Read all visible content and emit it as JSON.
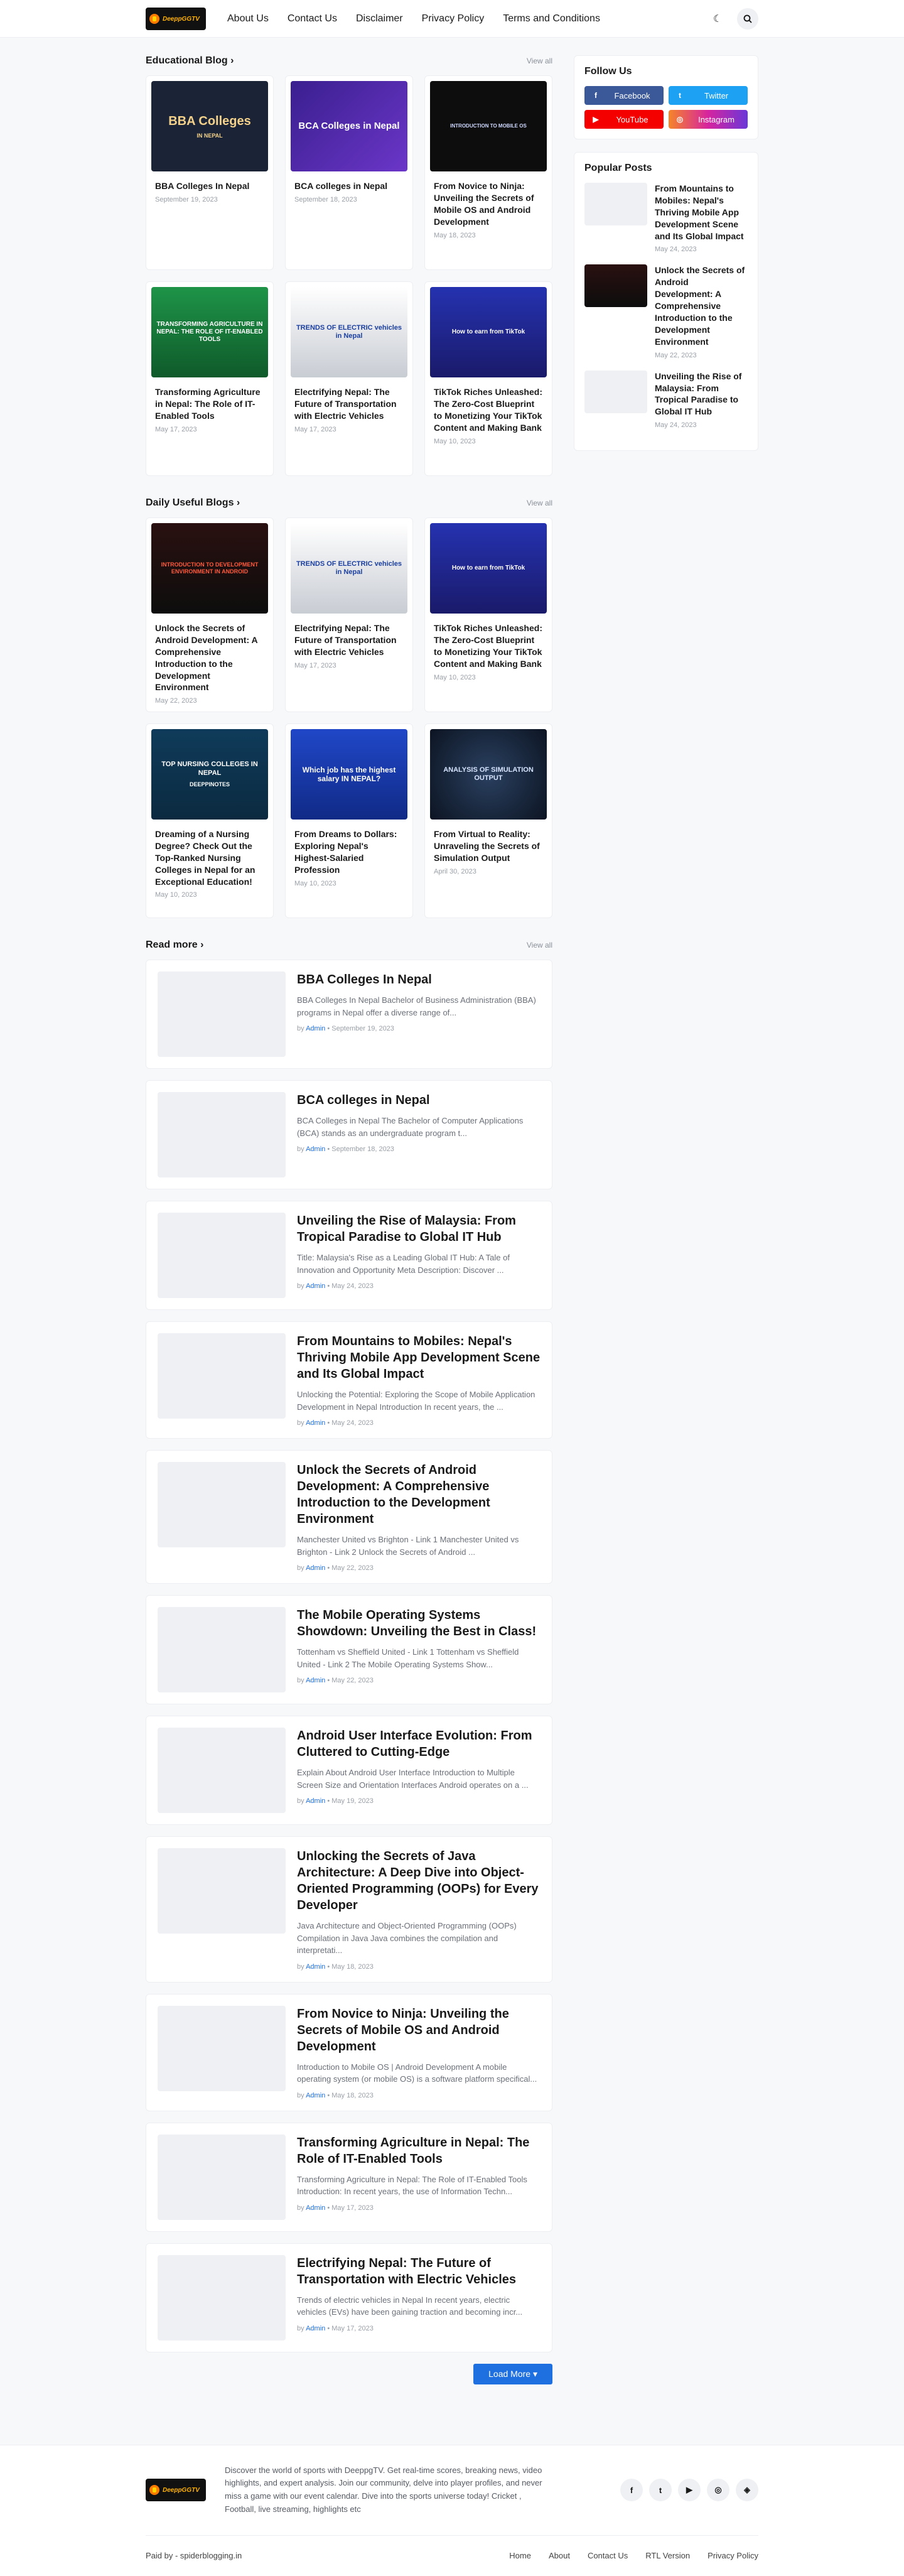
{
  "header": {
    "logo_text": "DeeppGGTV",
    "nav": [
      "About Us",
      "Contact Us",
      "Disclaimer",
      "Privacy Policy",
      "Terms and Conditions"
    ],
    "icons": {
      "theme": "moon-icon",
      "search": "search-icon"
    }
  },
  "sections": {
    "educational": {
      "title": "Educational Blog ›",
      "view_all": "View all",
      "cards": [
        {
          "title": "BBA Colleges In Nepal",
          "date": "September 19, 2023",
          "img_text": "BBA Colleges",
          "img_sub": "IN NEPAL"
        },
        {
          "title": "BCA colleges in Nepal",
          "date": "September 18, 2023",
          "img_text": "BCA Colleges in Nepal",
          "img_sub": ""
        },
        {
          "title": "From Novice to Ninja: Unveiling the Secrets of Mobile OS and Android Development",
          "date": "May 18, 2023",
          "img_text": "INTRODUCTION TO MOBILE OS",
          "img_sub": ""
        },
        {
          "title": "Transforming Agriculture in Nepal: The Role of IT-Enabled Tools",
          "date": "May 17, 2023",
          "img_text": "TRANSFORMING AGRICULTURE IN NEPAL: THE ROLE OF IT-ENABLED TOOLS",
          "img_sub": ""
        },
        {
          "title": "Electrifying Nepal: The Future of Transportation with Electric Vehicles",
          "date": "May 17, 2023",
          "img_text": "TRENDS OF ELECTRIC vehicles in Nepal",
          "img_sub": ""
        },
        {
          "title": "TikTok Riches Unleashed: The Zero-Cost Blueprint to Monetizing Your TikTok Content and Making Bank",
          "date": "May 10, 2023",
          "img_text": "How to earn from TikTok",
          "img_sub": ""
        }
      ]
    },
    "daily": {
      "title": "Daily Useful Blogs ›",
      "view_all": "View all",
      "cards": [
        {
          "title": "Unlock the Secrets of Android Development: A Comprehensive Introduction to the Development Environment",
          "date": "May 22, 2023",
          "img_text": "INTRODUCTION TO DEVELOPMENT ENVIRONMENT IN ANDROID",
          "img_sub": ""
        },
        {
          "title": "Electrifying Nepal: The Future of Transportation with Electric Vehicles",
          "date": "May 17, 2023",
          "img_text": "TRENDS OF ELECTRIC vehicles in Nepal",
          "img_sub": ""
        },
        {
          "title": "TikTok Riches Unleashed: The Zero-Cost Blueprint to Monetizing Your TikTok Content and Making Bank",
          "date": "May 10, 2023",
          "img_text": "How to earn from TikTok",
          "img_sub": ""
        },
        {
          "title": "Dreaming of a Nursing Degree? Check Out the Top-Ranked Nursing Colleges in Nepal for an Exceptional Education!",
          "date": "May 10, 2023",
          "img_text": "TOP NURSING COLLEGES IN NEPAL",
          "img_sub": "DEEPPINOTES"
        },
        {
          "title": "From Dreams to Dollars: Exploring Nepal's Highest-Salaried Profession",
          "date": "May 10, 2023",
          "img_text": "Which job has the highest salary IN NEPAL?",
          "img_sub": ""
        },
        {
          "title": "From Virtual to Reality: Unraveling the Secrets of Simulation Output",
          "date": "April 30, 2023",
          "img_text": "ANALYSIS OF SIMULATION OUTPUT",
          "img_sub": ""
        }
      ]
    },
    "read_more": {
      "title": "Read more ›",
      "view_all": "View all",
      "load_more": "Load More ▾",
      "by": "by",
      "author": "Admin",
      "items": [
        {
          "title": "BBA Colleges In Nepal",
          "snippet": "BBA Colleges In Nepal  Bachelor of Business Administration (BBA) programs in Nepal offer a diverse range of...",
          "date": "September 19, 2023"
        },
        {
          "title": "BCA colleges in Nepal",
          "snippet": "BCA Colleges in Nepal  The Bachelor of Computer Applications (BCA) stands as an undergraduate program t...",
          "date": "September 18, 2023"
        },
        {
          "title": "Unveiling the Rise of Malaysia: From Tropical Paradise to Global IT Hub",
          "snippet": "Title: Malaysia's Rise as a Leading Global IT Hub: A Tale of Innovation and Opportunity Meta Description:  Discover ...",
          "date": "May 24, 2023"
        },
        {
          "title": "From Mountains to Mobiles: Nepal's Thriving Mobile App Development Scene and Its Global Impact",
          "snippet": "Unlocking the Potential: Exploring the Scope of Mobile Application Development in Nepal Introduction In recent years, the ...",
          "date": "May 24, 2023"
        },
        {
          "title": "Unlock the Secrets of Android Development: A Comprehensive Introduction to the Development Environment",
          "snippet": "Manchester United vs Brighton - Link 1 Manchester United vs Brighton - Link 2  Unlock the Secrets of Android ...",
          "date": "May 22, 2023"
        },
        {
          "title": "The Mobile Operating Systems Showdown: Unveiling the Best in Class!",
          "snippet": "Tottenham vs Sheffield United - Link 1 Tottenham vs Sheffield United - Link 2 The Mobile Operating Systems Show...",
          "date": "May 22, 2023"
        },
        {
          "title": "Android User Interface Evolution: From Cluttered to Cutting-Edge",
          "snippet": "Explain About Android User Interface Introduction to Multiple Screen Size and Orientation Interfaces Android operates on a ...",
          "date": "May 19, 2023"
        },
        {
          "title": "Unlocking the Secrets of Java Architecture: A Deep Dive into Object-Oriented Programming (OOPs) for Every Developer",
          "snippet": "Java Architecture and Object-Oriented Programming (OOPs) Compilation in Java Java combines the compilation and interpretati...",
          "date": "May 18, 2023"
        },
        {
          "title": "From Novice to Ninja: Unveiling the Secrets of Mobile OS and Android Development",
          "snippet": "Introduction to Mobile OS | Android Development A mobile operating system (or mobile OS) is a software platform specifical...",
          "date": "May 18, 2023"
        },
        {
          "title": "Transforming Agriculture in Nepal: The Role of IT-Enabled Tools",
          "snippet": "Transforming Agriculture in Nepal: The Role of IT-Enabled Tools Introduction:  In recent years, the use of Information Techn...",
          "date": "May 17, 2023"
        },
        {
          "title": "Electrifying Nepal: The Future of Transportation with Electric Vehicles",
          "snippet": "Trends of electric vehicles in Nepal In recent years, electric vehicles (EVs) have been gaining traction and becoming incr...",
          "date": "May 17, 2023"
        }
      ]
    }
  },
  "sidebar": {
    "follow_title": "Follow Us",
    "follow": [
      {
        "label": "Facebook",
        "icon": "f",
        "color": "#3b5998"
      },
      {
        "label": "Twitter",
        "icon": "t",
        "color": "#1da1f2"
      },
      {
        "label": "YouTube",
        "icon": "▶",
        "color": "#f50000"
      },
      {
        "label": "Instagram",
        "icon": "◎",
        "color": "#d6249f"
      }
    ],
    "popular_title": "Popular Posts",
    "popular": [
      {
        "title": "From Mountains to Mobiles: Nepal's Thriving Mobile App Development Scene and Its Global Impact",
        "date": "May 24, 2023"
      },
      {
        "title": "Unlock the Secrets of Android Development: A Comprehensive Introduction to the Development Environment",
        "date": "May 22, 2023"
      },
      {
        "title": "Unveiling the Rise of Malaysia: From Tropical Paradise to Global IT Hub",
        "date": "May 24, 2023"
      }
    ]
  },
  "footer": {
    "description": "Discover the world of sports with DeeppgTV. Get real-time scores, breaking news, video highlights, and expert analysis. Join our community, delve into player profiles, and never miss a game with our event calendar. Dive into the sports universe today! Cricket , Football, live streaming, highlights etc",
    "socials": [
      "f",
      "t",
      "▶",
      "◎",
      "◈"
    ],
    "credit": "Paid by - spiderblogging.in",
    "links": [
      "Home",
      "About",
      "Contact Us",
      "RTL Version",
      "Privacy Policy"
    ]
  }
}
